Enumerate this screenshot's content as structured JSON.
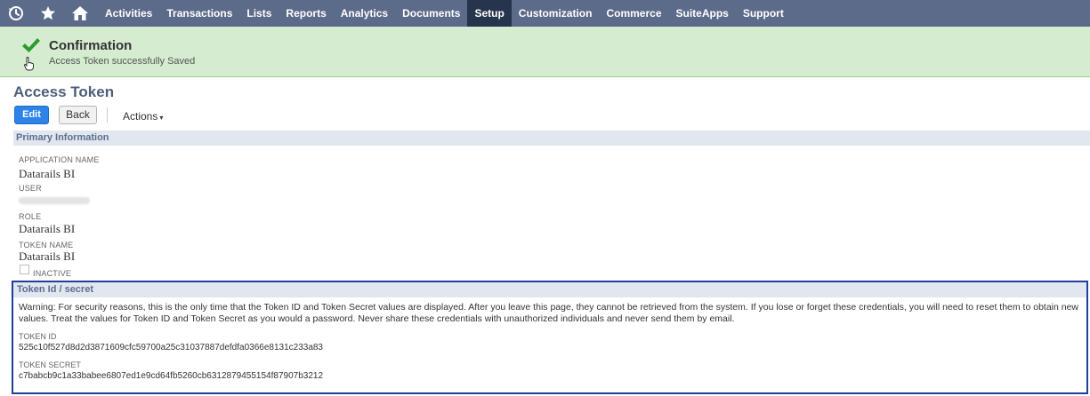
{
  "nav": {
    "icons": [
      "recent-icon",
      "star-icon",
      "home-icon"
    ],
    "items": [
      "Activities",
      "Transactions",
      "Lists",
      "Reports",
      "Analytics",
      "Documents",
      "Setup",
      "Customization",
      "Commerce",
      "SuiteApps",
      "Support"
    ],
    "active": "Setup"
  },
  "confirmation": {
    "title": "Confirmation",
    "message": "Access Token successfully Saved"
  },
  "page": {
    "title": "Access Token"
  },
  "buttons": {
    "edit": "Edit",
    "back": "Back",
    "actions": "Actions",
    "actions_caret": "▾"
  },
  "primary": {
    "header": "Primary Information",
    "application_name_label": "APPLICATION NAME",
    "application_name": "Datarails BI",
    "user_label": "USER",
    "role_label": "ROLE",
    "role": "Datarails BI",
    "token_name_label": "TOKEN NAME",
    "token_name": "Datarails BI",
    "inactive_label": "INACTIVE"
  },
  "token": {
    "header": "Token Id / secret",
    "warning": "Warning: For security reasons, this is the only time that the Token ID and Token Secret values are displayed. After you leave this page, they cannot be retrieved from the system. If you lose or forget these credentials, you will need to reset them to obtain new values. Treat the values for Token ID and Token Secret as you would a password. Never share these credentials with unauthorized individuals and never send them by email.",
    "id_label": "TOKEN ID",
    "id": "525c10f527d8d2d3871609cfc59700a25c31037887defdfa0366e8131c233a83",
    "secret_label": "TOKEN SECRET",
    "secret": "c7babcb9c1a33babee6807ed1e9cd64fb5260cb6312879455154f87907b3212"
  },
  "colors": {
    "nav_bg": "#5c6b8a",
    "nav_active": "#26354d",
    "confirm_bg": "#d5ecd0",
    "check": "#2e9a2e",
    "edit_button": "#2c83e8",
    "token_border": "#1f3f9c"
  }
}
